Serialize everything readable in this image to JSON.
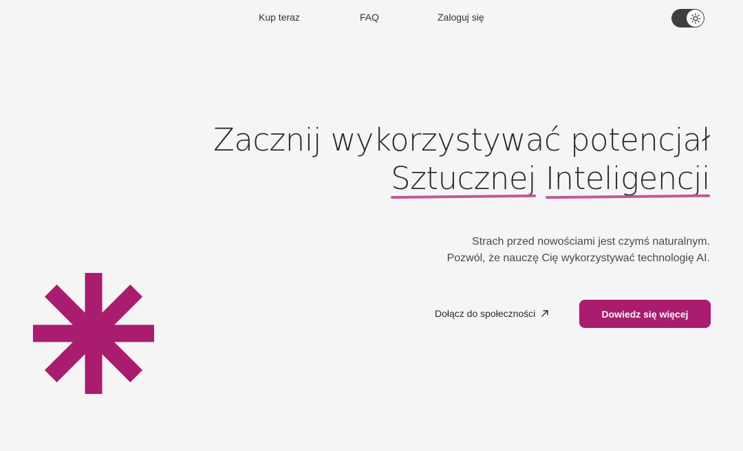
{
  "nav": {
    "buy_label": "Kup teraz",
    "faq_label": "FAQ",
    "login_label": "Zaloguj się"
  },
  "theme_toggle": {
    "icon": "sun-icon"
  },
  "hero": {
    "headline_line1": "Zacznij wykorzystywać potencjał",
    "headline_word1": "Sztucznej",
    "headline_word2": "Inteligencji",
    "subtext_line1": "Strach przed nowościami jest czymś naturalnym.",
    "subtext_line2": "Pozwól, że nauczę Cię wykorzystywać technologię AI."
  },
  "cta": {
    "community_label": "Dołącz do społeczności",
    "community_icon": "arrow-up-right-icon",
    "learn_more_label": "Dowiedz się więcej"
  },
  "colors": {
    "accent": "#a91c6e",
    "underline": "#c2589a",
    "background": "#f4f5f4",
    "toggle": "#3f3f42"
  },
  "decoration": {
    "icon": "asterisk-icon"
  }
}
